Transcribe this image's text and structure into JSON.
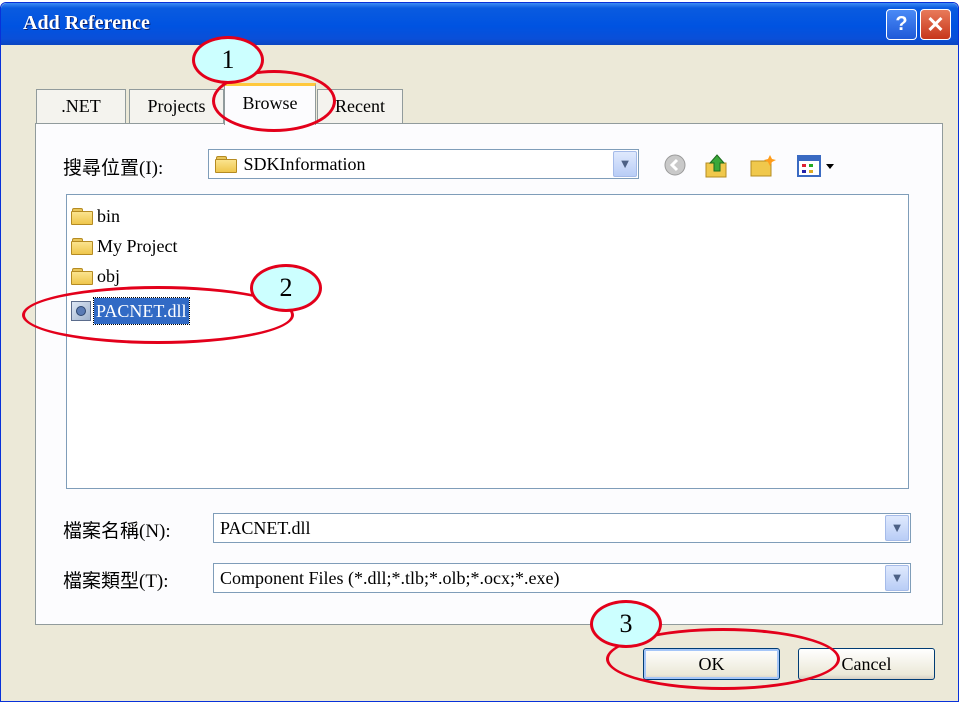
{
  "window": {
    "title": "Add Reference",
    "help_label": "?",
    "close_label": "✕"
  },
  "tabs": [
    {
      "label": ".NET"
    },
    {
      "label": "Projects"
    },
    {
      "label": "Browse"
    },
    {
      "label": "Recent"
    }
  ],
  "active_tab": "Browse",
  "lookin": {
    "label": "搜尋位置(I):",
    "value": "SDKInformation"
  },
  "toolbar": {
    "back_icon": "back-icon",
    "up_icon": "up-folder-icon",
    "newfolder_icon": "new-folder-icon",
    "views_icon": "views-menu-icon"
  },
  "files": [
    {
      "name": "bin",
      "type": "folder"
    },
    {
      "name": "My Project",
      "type": "folder"
    },
    {
      "name": "obj",
      "type": "folder"
    },
    {
      "name": "PACNET.dll",
      "type": "dll",
      "selected": true
    }
  ],
  "filename": {
    "label": "檔案名稱(N):",
    "value": "PACNET.dll"
  },
  "filetype": {
    "label": "檔案類型(T):",
    "value": "Component Files (*.dll;*.tlb;*.olb;*.ocx;*.exe)"
  },
  "buttons": {
    "ok": "OK",
    "cancel": "Cancel"
  },
  "markers": [
    "1",
    "2",
    "3"
  ],
  "colors": {
    "titlebar": "#0053e1",
    "annotation": "#e3001b",
    "marker_fill": "#ccffff",
    "selection": "#316ac5"
  }
}
